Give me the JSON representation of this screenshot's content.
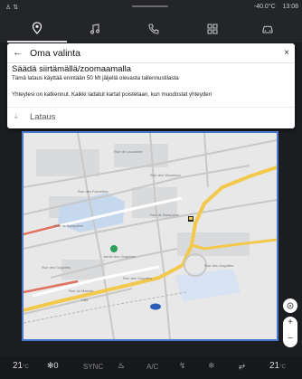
{
  "status_bar": {
    "left_icons": "♙ ⇅",
    "temperature": "-40.0°C",
    "time": "13:08"
  },
  "top_nav": {
    "items": [
      "navigation",
      "music",
      "phone",
      "apps",
      "vehicle"
    ],
    "active": "navigation"
  },
  "dialog": {
    "back_icon": "arrow-left-icon",
    "title": "Oma valinta",
    "close_label": "×",
    "heading": "Säädä siirtämällä/zoomaamalla",
    "storage_note": "Tämä lataus käyttää enintään 50 Mt jäljellä olevasta tallennustilasta",
    "offline_note": "Yhteytesi on katkennut. Kaikki ladatut kartat poistetaan, kun muodostat yhteyden",
    "download_label": "Lataus"
  },
  "map": {
    "streets": [
      "Rue de Lausanne",
      "Rue des Vanneaux",
      "Rue des Fauvettes",
      "Rue de Bampaine",
      "Rue de Bampaine",
      "Jardin des Gogottes",
      "Rue des Gogottes",
      "Rue des Gogottes",
      "Rue des Gogottes",
      "Rue du Marché",
      "D88"
    ],
    "colors": {
      "accent": "#4a7ad0",
      "highway": "#f2c94c",
      "park_pin": "#2e9e5b",
      "position": "#2d5fb8"
    }
  },
  "bottom_bar": {
    "left_temp": "21",
    "left_temp_unit": "°C",
    "fan_level": "0",
    "sync_label": "SYNC",
    "ac_label": "A/C",
    "right_temp": "21",
    "right_temp_unit": "°C"
  }
}
